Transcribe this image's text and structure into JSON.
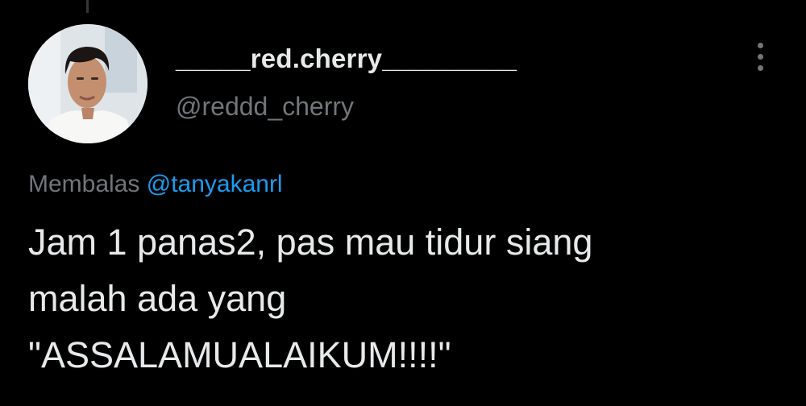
{
  "tweet": {
    "author": {
      "display_name": "_____red.cherry_________",
      "handle": "@reddd_cherry",
      "avatar_icon": "profile-photo"
    },
    "more_icon": "more-vertical-icon",
    "reply": {
      "prefix": "Membalas",
      "mention": "@tanyakanrl"
    },
    "text_lines": [
      "Jam 1 panas2, pas mau tidur siang",
      "malah ada yang",
      "\"ASSALAMUALAIKUM!!!!\""
    ]
  },
  "colors": {
    "background": "#000000",
    "primary_text": "#e7e9ea",
    "secondary_text": "#71767b",
    "link": "#1d9bf0"
  }
}
